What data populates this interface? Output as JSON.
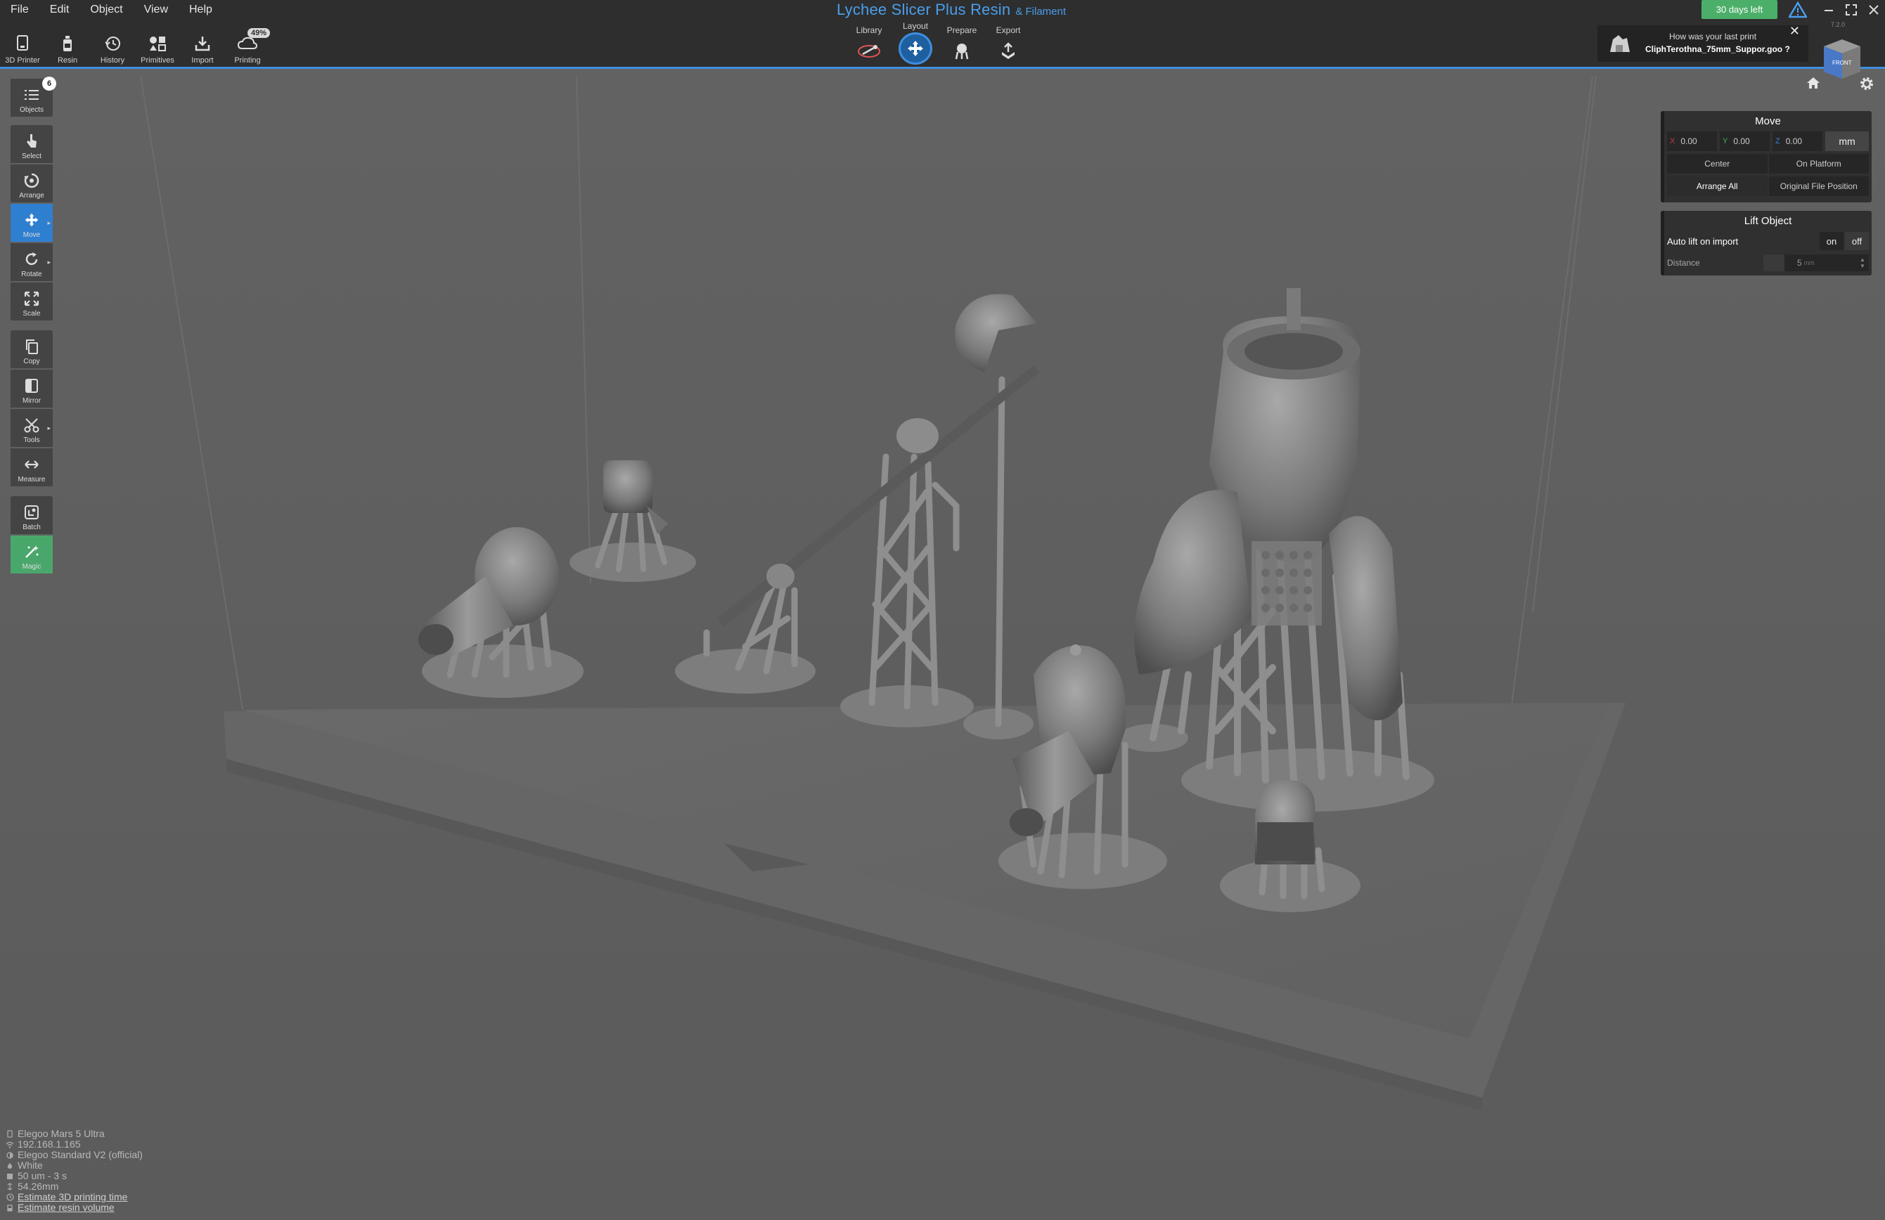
{
  "menu": [
    "File",
    "Edit",
    "Object",
    "View",
    "Help"
  ],
  "app": {
    "title": "Lychee Slicer Plus Resin",
    "subtitle": "& Filament"
  },
  "toolbar": {
    "items": [
      "3D Printer",
      "Resin",
      "History",
      "Primitives",
      "Import",
      "Printing"
    ],
    "printing_badge": "49%"
  },
  "modes": {
    "items": [
      "Library",
      "Layout",
      "Prepare",
      "Export"
    ],
    "active": "Layout"
  },
  "trial": "30 days left",
  "notification": {
    "question": "How was your last print",
    "file": "CliphTerothna_75mm_Suppor.goo ?"
  },
  "version": "7.2.0",
  "view_cube": "FRONT",
  "sidebar": {
    "objects_count": "6",
    "items": [
      "Objects",
      "Select",
      "Arrange",
      "Move",
      "Rotate",
      "Scale",
      "Copy",
      "Mirror",
      "Tools",
      "Measure",
      "Batch",
      "Magic"
    ]
  },
  "move_panel": {
    "title": "Move",
    "x": "0.00",
    "y": "0.00",
    "z": "0.00",
    "axis_x": "X",
    "axis_y": "Y",
    "axis_z": "Z",
    "unit": "mm",
    "center": "Center",
    "on_platform": "On Platform",
    "arrange_all": "Arrange All",
    "original_position": "Original File Position"
  },
  "lift_panel": {
    "title": "Lift Object",
    "auto_lift_label": "Auto lift on import",
    "on": "on",
    "off": "off",
    "distance_label": "Distance",
    "distance_value": "5",
    "distance_unit": "mm"
  },
  "status": {
    "printer": "Elegoo Mars 5 Ultra",
    "ip": "192.168.1.165",
    "resin": "Elegoo Standard V2 (official)",
    "color": "White",
    "layer": "50 um - 3 s",
    "height": "54.26mm",
    "estimate_time": "Estimate 3D printing time",
    "estimate_volume": "Estimate resin volume"
  },
  "colors": {
    "accent": "#3d8fe0",
    "trial": "#4caf69",
    "magic": "#4aa76b",
    "background": "#5e5e5e"
  }
}
